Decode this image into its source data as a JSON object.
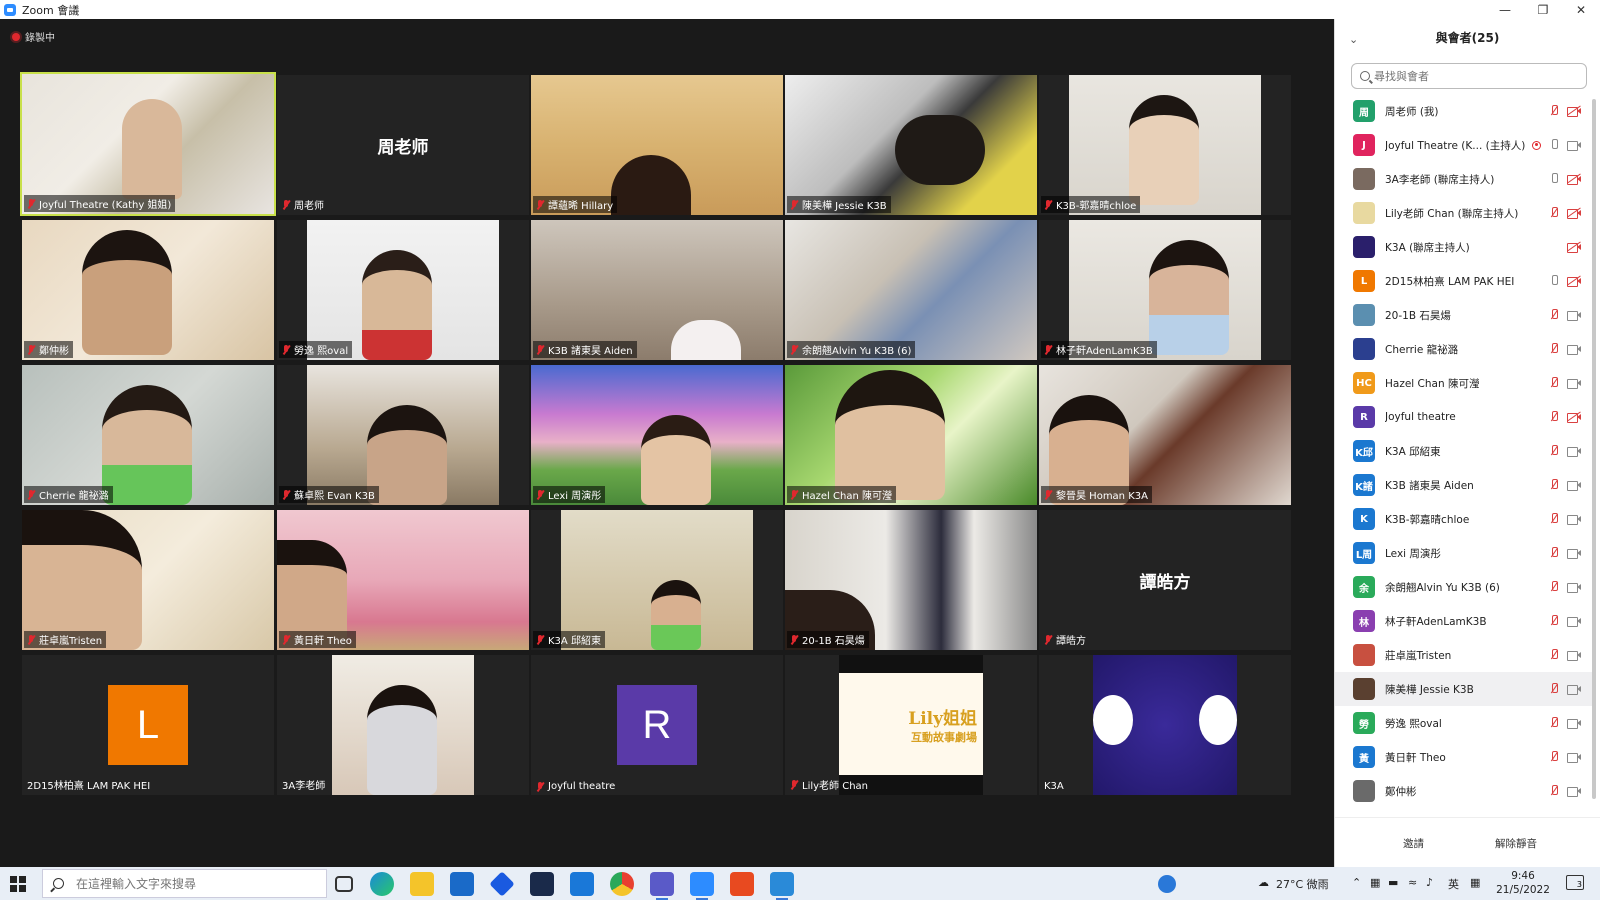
{
  "window": {
    "title": "Zoom 會議"
  },
  "recording": {
    "label": "錄製中"
  },
  "tiles": {
    "r1c1": "Joyful Theatre (Kathy 姐姐)",
    "r1c2": "周老师",
    "r1c2_big": "周老师",
    "r1c3": "譚蘊晞 Hillary",
    "r1c4": "陳美樺 Jessie K3B",
    "r1c5": "K3B-郭嘉晴chloe",
    "r2c1": "鄭仲彬",
    "r2c2": "勞逸 熙oval",
    "r2c3": "K3B 諸東昊 Aiden",
    "r2c4": "余朗翹Alvin Yu K3B (6)",
    "r2c5": "林子軒AdenLamK3B",
    "r3c1": "Cherrie 龍祕潞",
    "r3c2": "蘇卓熙 Evan K3B",
    "r3c3": "Lexi 周演彤",
    "r3c4": "Hazel Chan 陳可瀅",
    "r3c5": "黎晉昊 Homan K3A",
    "r4c1": "莊卓嵐Tristen",
    "r4c2": "黃日軒 Theo",
    "r4c3": "K3A 邱紹東",
    "r4c4": "20-1B 石昊煬",
    "r4c5": "譚皓方",
    "r4c5_big": "譚皓方",
    "r5c1": "2D15林柏熹 LAM PAK HEI",
    "r5c1_avatar": "L",
    "r5c2": "3A李老師",
    "r5c3": "Joyful theatre",
    "r5c3_avatar": "R",
    "r5c4": "Lily老師 Chan",
    "r5c4_logo": "Lily姐姐",
    "r5c4_logo_sub": "互動故事劇場",
    "r5c5": "K3A"
  },
  "panel": {
    "title": "與會者(25)",
    "search_placeholder": "尋找與會者",
    "participants": [
      {
        "avatar": "周",
        "color": "#22a06b",
        "name": "周老师 (我)",
        "mic": "muted",
        "cam": "off"
      },
      {
        "avatar": "J",
        "color": "#e0245e",
        "name": "Joyful Theatre (K... (主持人)",
        "mic": "on",
        "rec": true,
        "cam": "on"
      },
      {
        "avatar": "",
        "color": "#7a6a60",
        "name": "3A李老師 (聯席主持人)",
        "mic": "on",
        "cam": "off"
      },
      {
        "avatar": "",
        "color": "#e8d9a0",
        "name": "Lily老師 Chan (聯席主持人)",
        "mic": "muted",
        "cam": "off"
      },
      {
        "avatar": "",
        "color": "#2a1f6b",
        "name": "K3A (聯席主持人)",
        "mic": "none",
        "cam": "off"
      },
      {
        "avatar": "L",
        "color": "#f07800",
        "name": "2D15林柏熹 LAM PAK HEI",
        "mic": "on",
        "cam": "off"
      },
      {
        "avatar": "",
        "color": "#5b8fb0",
        "name": "20-1B 石昊煬",
        "mic": "muted",
        "cam": "on"
      },
      {
        "avatar": "",
        "color": "#2b3f8f",
        "name": "Cherrie 龍祕潞",
        "mic": "muted",
        "cam": "on"
      },
      {
        "avatar": "HC",
        "color": "#f09a1a",
        "name": "Hazel Chan 陳可瀅",
        "mic": "muted",
        "cam": "on"
      },
      {
        "avatar": "R",
        "color": "#5a3aa8",
        "name": "Joyful theatre",
        "mic": "muted",
        "cam": "off"
      },
      {
        "avatar": "K邱",
        "color": "#1b78d0",
        "name": "K3A 邱紹東",
        "mic": "muted",
        "cam": "on"
      },
      {
        "avatar": "K諸",
        "color": "#1b78d0",
        "name": "K3B 諸東昊 Aiden",
        "mic": "muted",
        "cam": "on"
      },
      {
        "avatar": "K",
        "color": "#1b78d0",
        "name": "K3B-郭嘉晴chloe",
        "mic": "muted",
        "cam": "on"
      },
      {
        "avatar": "L周",
        "color": "#1b78d0",
        "name": "Lexi 周演彤",
        "mic": "muted",
        "cam": "on"
      },
      {
        "avatar": "余",
        "color": "#2aaa5a",
        "name": "余朗翹Alvin Yu K3B (6)",
        "mic": "muted",
        "cam": "on"
      },
      {
        "avatar": "林",
        "color": "#8a3fb0",
        "name": "林子軒AdenLamK3B",
        "mic": "muted",
        "cam": "on"
      },
      {
        "avatar": "",
        "color": "#c85040",
        "name": "莊卓嵐Tristen",
        "mic": "muted",
        "cam": "on"
      },
      {
        "avatar": "",
        "color": "#5a4030",
        "name": "陳美樺 Jessie K3B",
        "mic": "muted",
        "cam": "on",
        "highlight": true
      },
      {
        "avatar": "勞",
        "color": "#2aaa5a",
        "name": "勞逸 熙oval",
        "mic": "muted",
        "cam": "on"
      },
      {
        "avatar": "黃",
        "color": "#1b78d0",
        "name": "黃日軒 Theo",
        "mic": "muted",
        "cam": "on"
      },
      {
        "avatar": "",
        "color": "#6a6a6a",
        "name": "鄭仲彬",
        "mic": "muted",
        "cam": "on"
      }
    ],
    "invite_label": "邀請",
    "unmute_label": "解除靜音"
  },
  "taskbar": {
    "search_placeholder": "在這裡輸入文字來搜尋",
    "weather": "27°C 微雨",
    "lang": "英",
    "time": "9:46",
    "date": "21/5/2022",
    "notif_count": "3"
  }
}
